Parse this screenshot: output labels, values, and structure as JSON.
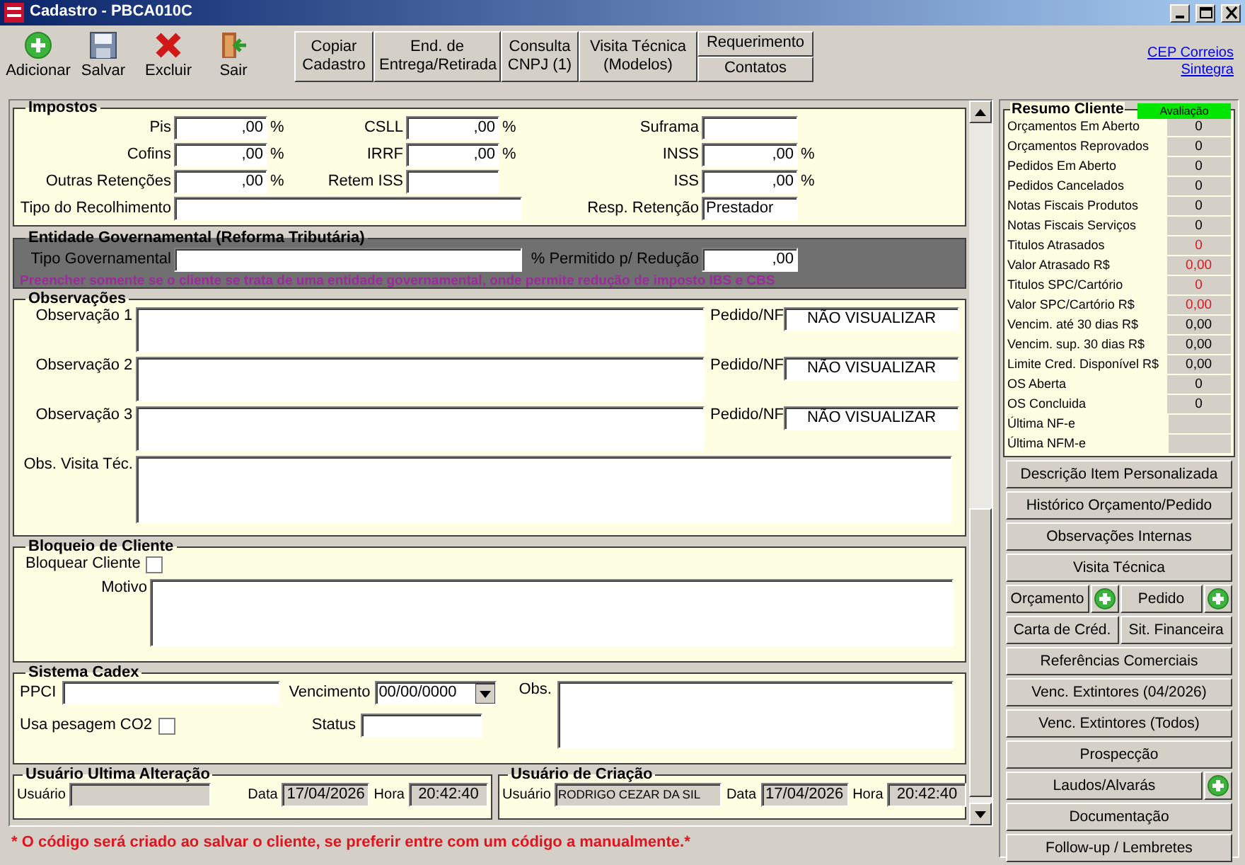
{
  "window": {
    "title": "Cadastro - PBCA010C"
  },
  "toolbar": {
    "tools": [
      {
        "label": "Adicionar",
        "kind": "add"
      },
      {
        "label": "Salvar",
        "kind": "save"
      },
      {
        "label": "Excluir",
        "kind": "delete"
      },
      {
        "label": "Sair",
        "kind": "exit"
      }
    ],
    "buttons": [
      {
        "label": "Copiar\nCadastro"
      },
      {
        "label": "End. de\nEntrega/Retirada"
      },
      {
        "label": "Consulta\nCNPJ (1)"
      },
      {
        "label": "Visita Técnica\n(Modelos)"
      }
    ],
    "stacked_buttons": [
      "Requerimento",
      "Contatos"
    ],
    "links": [
      "CEP Correios",
      "Sintegra"
    ]
  },
  "impostos": {
    "title": "Impostos",
    "rows": [
      [
        {
          "label": "Pis",
          "kind": "percent",
          "value": ",00",
          "unit": "%"
        },
        {
          "label": "CSLL",
          "kind": "percent",
          "value": ",00",
          "unit": "%"
        },
        {
          "label": "Suframa",
          "kind": "text"
        }
      ],
      [
        {
          "label": "Cofins",
          "kind": "percent",
          "value": ",00",
          "unit": "%"
        },
        {
          "label": "IRRF",
          "kind": "percent",
          "value": ",00",
          "unit": "%"
        },
        {
          "label": "INSS",
          "kind": "percent",
          "value": ",00",
          "unit": "%"
        }
      ],
      [
        {
          "label": "Outras Retenções",
          "kind": "percent",
          "value": ",00",
          "unit": "%"
        },
        {
          "label": "Retem ISS",
          "kind": "text"
        },
        {
          "label": "ISS",
          "kind": "percent",
          "value": ",00",
          "unit": "%"
        }
      ],
      [
        {
          "label": "Tipo do Recolhimento",
          "kind": "long"
        },
        "",
        {
          "label": "Resp. Retenção",
          "kind": "text",
          "value": "Prestador"
        }
      ]
    ]
  },
  "entidade": {
    "title": "Entidade Governamental (Reforma Tributária)",
    "rows": [
      [
        {
          "label": "Tipo Governamental",
          "kind": "long"
        },
        "",
        {
          "label": "% Permitido p/ Redução",
          "kind": "percent",
          "value": ",00"
        }
      ]
    ],
    "note": "Preencher somente se o cliente se trata de uma entidade governamental, onde permite redução de imposto IBS e CBS"
  },
  "observacoes": {
    "title": "Observações",
    "rows": [
      {
        "label": "Observação 1",
        "nf_label": "Pedido/NF",
        "nf_value": "NÃO VISUALIZAR"
      },
      {
        "label": "Observação 2",
        "nf_label": "Pedido/NF",
        "nf_value": "NÃO VISUALIZAR"
      },
      {
        "label": "Observação 3",
        "nf_label": "Pedido/NF",
        "nf_value": "NÃO VISUALIZAR"
      }
    ],
    "visit_label": "Obs. Visita Téc."
  },
  "bloqueio": {
    "title": "Bloqueio de Cliente",
    "checkbox": {
      "label": "Bloquear Cliente",
      "checked": false
    },
    "reason_label": "Motivo"
  },
  "cadex": {
    "title": "Sistema Cadex",
    "ppci_label": "PPCI",
    "due_label": "Vencimento",
    "due_value": "00/00/0000",
    "obs_label": "Obs.",
    "co2": {
      "label": "Usa pesagem CO2",
      "checked": false
    },
    "status_label": "Status"
  },
  "users": [
    {
      "title": "Usuário Ultima Alteração",
      "user_label": "Usuário",
      "date_label": "Data",
      "date": "17/04/2026",
      "time_label": "Hora",
      "time": "20:42:40"
    },
    {
      "title": "Usuário de Criação",
      "user_label": "Usuário",
      "user": "RODRIGO CEZAR DA SIL",
      "date_label": "Data",
      "date": "17/04/2026",
      "time_label": "Hora",
      "time": "20:42:40"
    }
  ],
  "message": "* O código será criado ao salvar o cliente, se preferir entre com um código a manualmente.*",
  "resumo": {
    "title": "Resumo Cliente",
    "badge": "Avaliação",
    "rows": [
      {
        "label": "Orçamentos Em Aberto",
        "value": "0",
        "alert": false
      },
      {
        "label": "Orçamentos Reprovados",
        "value": "0",
        "alert": false
      },
      {
        "label": "Pedidos Em Aberto",
        "value": "0",
        "alert": false
      },
      {
        "label": "Pedidos Cancelados",
        "value": "0",
        "alert": false
      },
      {
        "label": "Notas Fiscais Produtos",
        "value": "0",
        "alert": false
      },
      {
        "label": "Notas Fiscais Serviços",
        "value": "0",
        "alert": false
      },
      {
        "label": "Titulos Atrasados",
        "value": "0",
        "alert": true
      },
      {
        "label": "Valor Atrasado R$",
        "value": "0,00",
        "alert": true
      },
      {
        "label": "Titulos SPC/Cartório",
        "value": "0",
        "alert": true
      },
      {
        "label": "Valor SPC/Cartório R$",
        "value": "0,00",
        "alert": true
      },
      {
        "label": "Vencim. até 30 dias R$",
        "value": "0,00",
        "alert": false
      },
      {
        "label": "Vencim. sup. 30 dias R$",
        "value": "0,00",
        "alert": false
      },
      {
        "label": "Limite Cred. Disponível R$",
        "value": "0,00",
        "alert": false
      },
      {
        "label": "OS Aberta",
        "value": "0",
        "alert": false
      },
      {
        "label": "OS Concluida",
        "value": "0",
        "alert": false
      },
      {
        "label": "Última NF-e",
        "kind": "wide"
      },
      {
        "label": "Última NFM-e",
        "kind": "wide"
      }
    ]
  },
  "side_buttons": [
    [
      {
        "label": "Descrição Item Personalizada",
        "add": false
      }
    ],
    [
      {
        "label": "Histórico Orçamento/Pedido",
        "add": false
      }
    ],
    [
      {
        "label": "Observações Internas",
        "add": false
      }
    ],
    [
      {
        "label": "Visita Técnica",
        "add": false
      }
    ],
    [
      {
        "label": "Orçamento",
        "add": true
      },
      {
        "label": "Pedido",
        "add": true
      }
    ],
    [
      {
        "label": "Carta de Créd.",
        "add": false
      },
      {
        "label": "Sit. Financeira",
        "add": false
      }
    ],
    [
      {
        "label": "Referências Comerciais",
        "add": false
      }
    ],
    [
      {
        "label": "Venc. Extintores (04/2026)",
        "add": false
      }
    ],
    [
      {
        "label": "Venc. Extintores (Todos)",
        "add": false
      }
    ],
    [
      {
        "label": "Prospecção",
        "add": false
      }
    ],
    [
      {
        "label": "Laudos/Alvarás",
        "add": true
      }
    ],
    [
      {
        "label": "Documentação",
        "add": false
      }
    ],
    [
      {
        "label": "Follow-up / Lembretes",
        "add": false
      }
    ]
  ]
}
